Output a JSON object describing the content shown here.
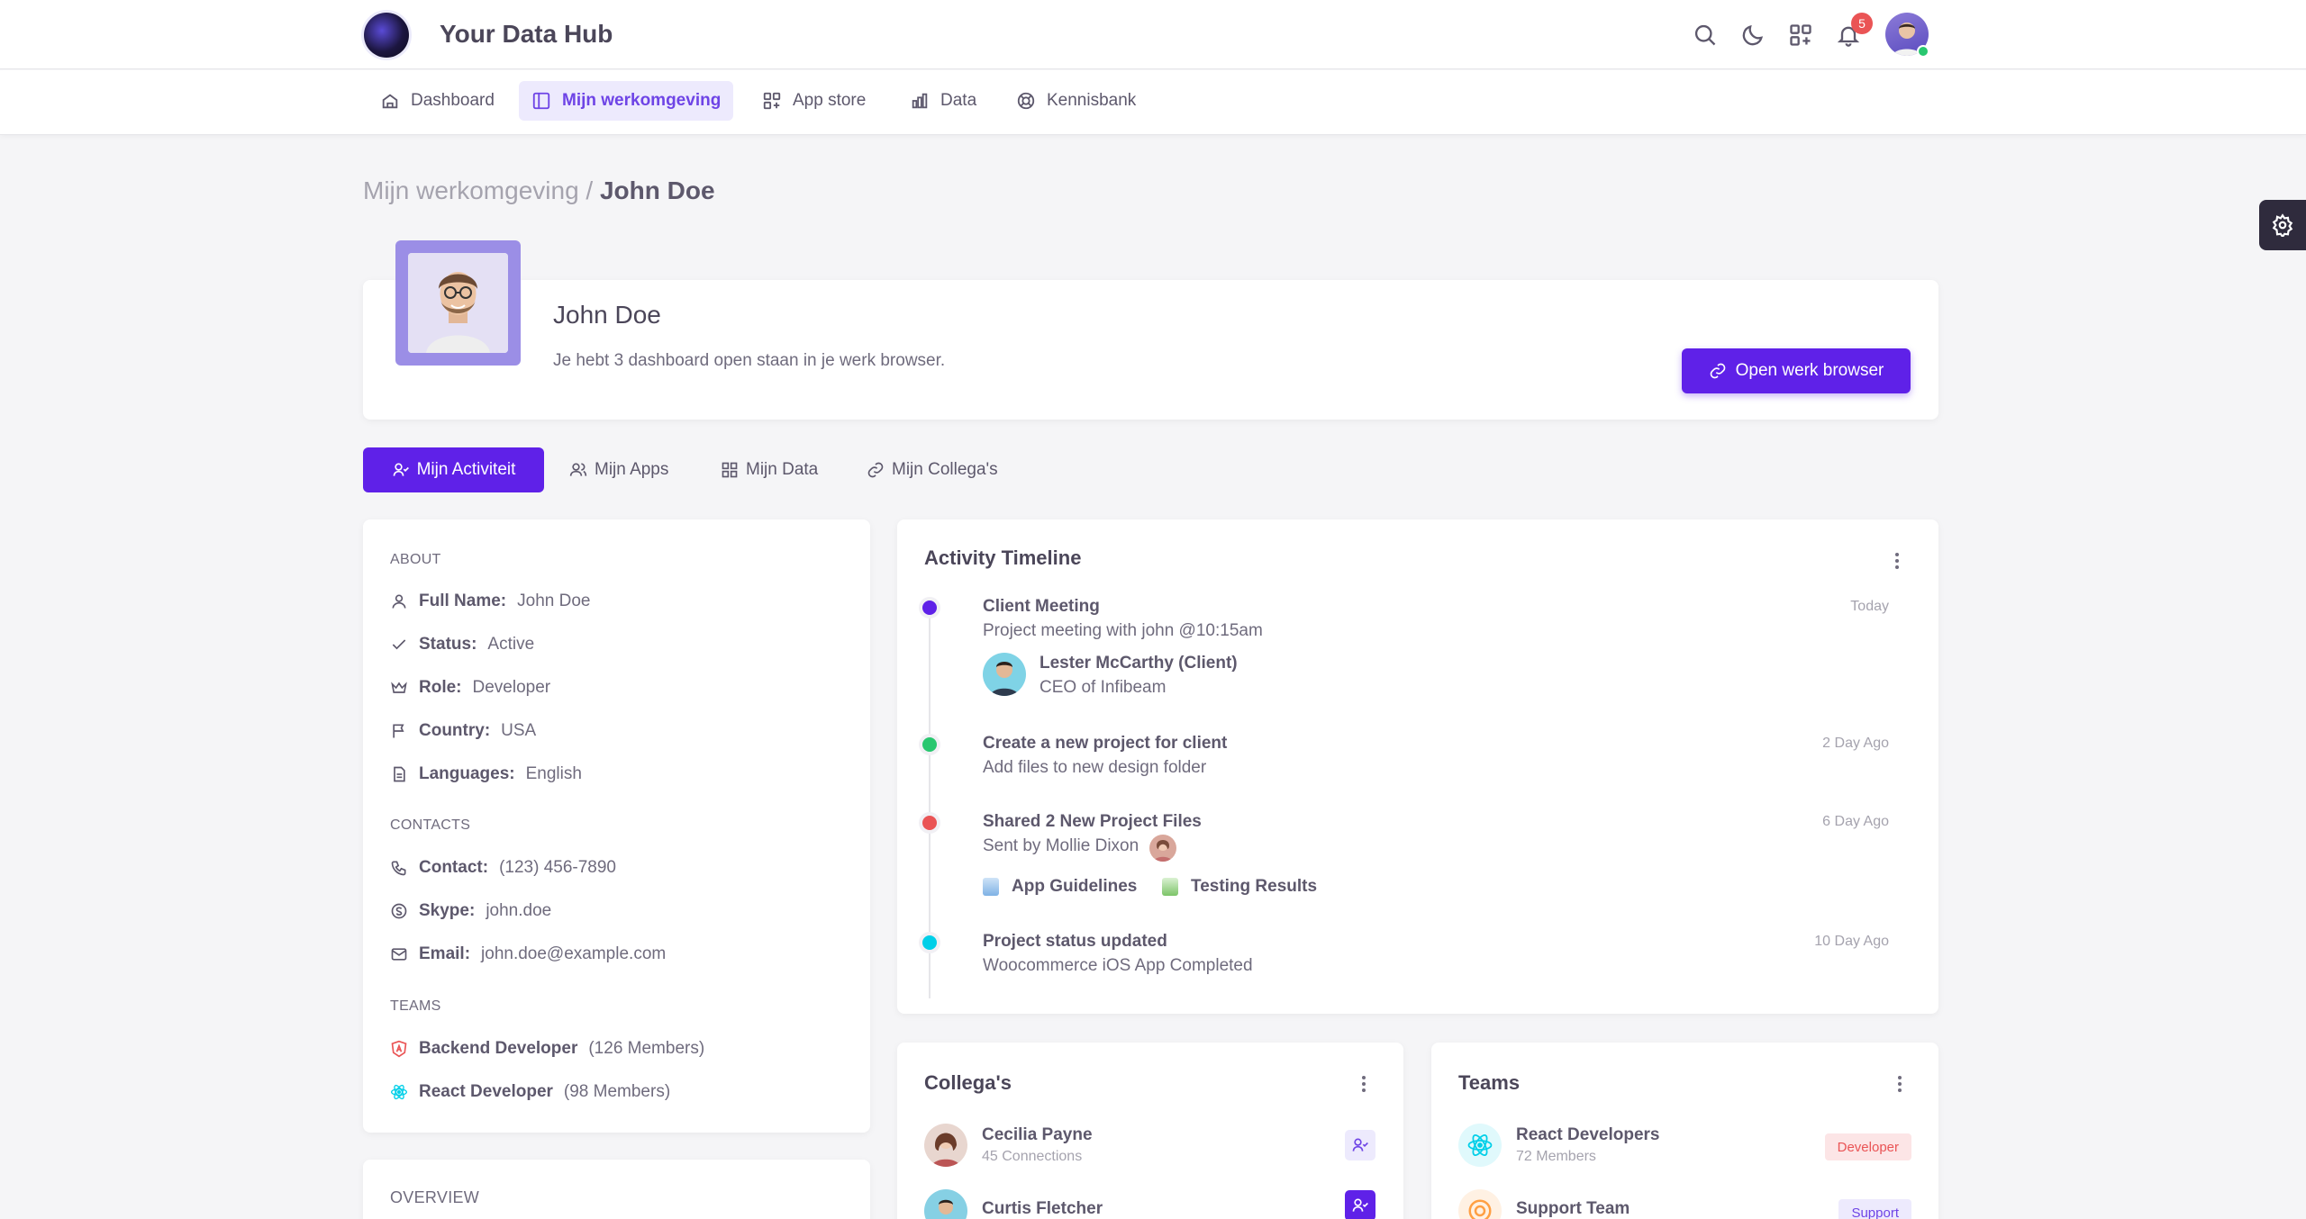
{
  "app": {
    "title": "Your Data Hub",
    "notification_count": "5"
  },
  "nav": [
    {
      "label": "Dashboard",
      "icon": "home-icon"
    },
    {
      "label": "Mijn werkomgeving",
      "icon": "layout-sidebar-icon",
      "active": true
    },
    {
      "label": "App store",
      "icon": "apps-add-icon"
    },
    {
      "label": "Data",
      "icon": "bar-chart-icon"
    },
    {
      "label": "Kennisbank",
      "icon": "lifebuoy-icon"
    }
  ],
  "breadcrumb": {
    "parent": "Mijn werkomgeving /",
    "current": "John Doe"
  },
  "profile": {
    "name": "John Doe",
    "subtitle": "Je hebt 3 dashboard open staan in je werk browser.",
    "button_label": "Open werk browser"
  },
  "tabs": [
    {
      "label": "Mijn Activiteit",
      "icon": "user-check-icon",
      "active": true
    },
    {
      "label": "Mijn Apps",
      "icon": "users-icon"
    },
    {
      "label": "Mijn Data",
      "icon": "grid-icon"
    },
    {
      "label": "Mijn Collega's",
      "icon": "link-icon"
    }
  ],
  "about": {
    "label": "ABOUT",
    "rows": [
      {
        "key": "Full Name:",
        "value": "John Doe",
        "icon": "user-icon"
      },
      {
        "key": "Status:",
        "value": "Active",
        "icon": "check-icon"
      },
      {
        "key": "Role:",
        "value": "Developer",
        "icon": "crown-icon"
      },
      {
        "key": "Country:",
        "value": "USA",
        "icon": "flag-icon"
      },
      {
        "key": "Languages:",
        "value": "English",
        "icon": "file-icon"
      }
    ],
    "contacts_label": "CONTACTS",
    "contacts": [
      {
        "key": "Contact:",
        "value": "(123) 456-7890",
        "icon": "phone-icon"
      },
      {
        "key": "Skype:",
        "value": "john.doe",
        "icon": "skype-icon"
      },
      {
        "key": "Email:",
        "value": "john.doe@example.com",
        "icon": "mail-icon"
      }
    ],
    "teams_label": "TEAMS",
    "teams": [
      {
        "key": "Backend Developer",
        "value": "(126 Members)",
        "icon": "angular-icon",
        "color": "#ea5455"
      },
      {
        "key": "React Developer",
        "value": "(98 Members)",
        "icon": "react-icon",
        "color": "#00cfe8"
      }
    ],
    "overview_label": "OVERVIEW"
  },
  "timeline": {
    "title": "Activity Timeline",
    "items": [
      {
        "title": "Client Meeting",
        "text": "Project meeting with john @10:15am",
        "time": "Today",
        "color": "#5f21e8"
      },
      {
        "title": "Create a new project for client",
        "text": "Add files to new design folder",
        "time": "2 Day Ago",
        "color": "#28c76f"
      },
      {
        "title": "Shared 2 New Project Files",
        "text": "Sent by Mollie Dixon",
        "time": "6 Day Ago",
        "color": "#ea5455"
      },
      {
        "title": "Project status updated",
        "text": "Woocommerce iOS App Completed",
        "time": "10 Day Ago",
        "color": "#00cfe8"
      }
    ],
    "client": {
      "name": "Lester McCarthy (Client)",
      "role": "CEO of Infibeam"
    },
    "files": [
      "App Guidelines",
      "Testing Results"
    ]
  },
  "collegas": {
    "title": "Collega's",
    "people": [
      {
        "name": "Cecilia Payne",
        "sub": "45 Connections"
      },
      {
        "name": "Curtis Fletcher",
        "sub": ""
      }
    ]
  },
  "teams_card": {
    "title": "Teams",
    "items": [
      {
        "name": "React Developers",
        "sub": "72 Members",
        "tag": "Developer"
      },
      {
        "name": "Support Team",
        "sub": "",
        "tag": "Support"
      }
    ]
  },
  "colors": {
    "primary": "#5f21e8",
    "success": "#28c76f",
    "danger": "#ea5455",
    "info": "#00cfe8"
  }
}
